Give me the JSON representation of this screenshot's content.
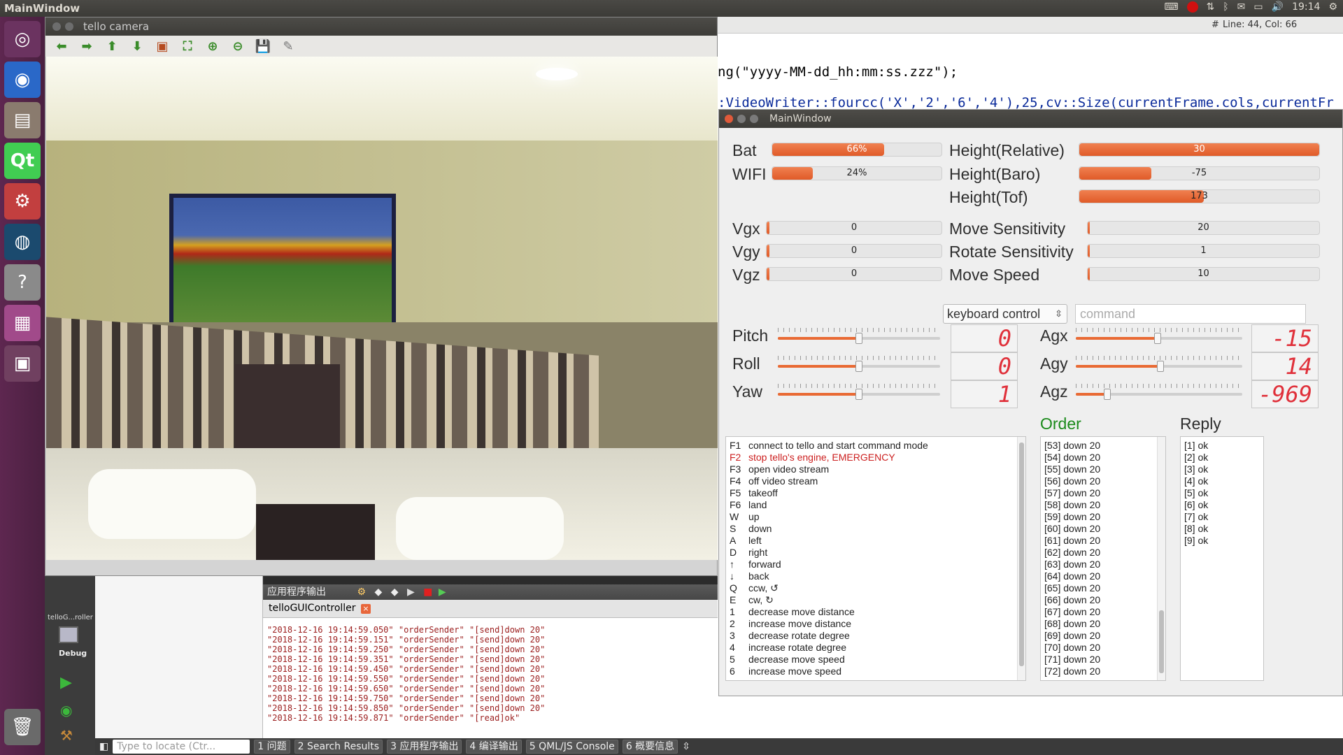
{
  "topbar": {
    "title": "MainWindow",
    "time": "19:14"
  },
  "editor": {
    "status": "Line: 44, Col: 66",
    "hash": "#",
    "line1": "ng(\"yyyy-MM-dd_hh:mm:ss.zzz\");",
    "line2": ":VideoWriter::fourcc('X','2','6','4'),25,cv::Size(currentFrame.cols,currentFr"
  },
  "camera": {
    "title": "tello camera"
  },
  "main": {
    "title": "MainWindow",
    "bat": {
      "label": "Bat",
      "text": "66%",
      "value": 0.66
    },
    "wifi": {
      "label": "WIFI",
      "text": "24%",
      "value": 0.24
    },
    "hrel": {
      "label": "Height(Relative)",
      "text": "30",
      "value": 1.0
    },
    "hbaro": {
      "label": "Height(Baro)",
      "text": "-75",
      "value": 0.3
    },
    "htof": {
      "label": "Height(Tof)",
      "text": "173",
      "value": 0.52
    },
    "vgx": {
      "label": "Vgx",
      "text": "0",
      "value": 0
    },
    "vgy": {
      "label": "Vgy",
      "text": "0",
      "value": 0
    },
    "vgz": {
      "label": "Vgz",
      "text": "0",
      "value": 0
    },
    "msens": {
      "label": "Move Sensitivity",
      "text": "20",
      "value": 0.01
    },
    "rsens": {
      "label": "Rotate Sensitivity",
      "text": "1",
      "value": 0.01
    },
    "mspeed": {
      "label": "Move Speed",
      "text": "10",
      "value": 0.01
    },
    "mode": "keyboard control",
    "command_placeholder": "command",
    "pitch": {
      "label": "Pitch",
      "lcd": "0",
      "value": 0.5
    },
    "roll": {
      "label": "Roll",
      "lcd": "0",
      "value": 0.5
    },
    "yaw": {
      "label": "Yaw",
      "lcd": "1",
      "value": 0.5
    },
    "agx": {
      "label": "Agx",
      "lcd": "-15",
      "value": 0.49
    },
    "agy": {
      "label": "Agy",
      "lcd": "14",
      "value": 0.51
    },
    "agz": {
      "label": "Agz",
      "lcd": "-969",
      "value": 0.19
    },
    "order_title": "Order",
    "reply_title": "Reply"
  },
  "keys": [
    {
      "k": "F1",
      "d": "connect to tello and start command mode"
    },
    {
      "k": "F2",
      "d": "stop tello's engine, EMERGENCY"
    },
    {
      "k": "F3",
      "d": "open video stream"
    },
    {
      "k": "F4",
      "d": "off video stream"
    },
    {
      "k": "F5",
      "d": "takeoff"
    },
    {
      "k": "F6",
      "d": "land"
    },
    {
      "k": "W",
      "d": "up"
    },
    {
      "k": "S",
      "d": "down"
    },
    {
      "k": "A",
      "d": "left"
    },
    {
      "k": "D",
      "d": "right"
    },
    {
      "k": "↑",
      "d": "forward"
    },
    {
      "k": "↓",
      "d": "back"
    },
    {
      "k": "Q",
      "d": "ccw, ↺"
    },
    {
      "k": "E",
      "d": "cw, ↻"
    },
    {
      "k": "1",
      "d": "decrease move distance"
    },
    {
      "k": "2",
      "d": "increase move distance"
    },
    {
      "k": "3",
      "d": "decrease rotate degree"
    },
    {
      "k": "4",
      "d": "increase rotate degree"
    },
    {
      "k": "5",
      "d": "decrease move speed"
    },
    {
      "k": "6",
      "d": "increase move speed"
    }
  ],
  "orders": [
    "[53] down 20",
    "[54] down 20",
    "[55] down 20",
    "[56] down 20",
    "[57] down 20",
    "[58] down 20",
    "[59] down 20",
    "[60] down 20",
    "[61] down 20",
    "[62] down 20",
    "[63] down 20",
    "[64] down 20",
    "[65] down 20",
    "[66] down 20",
    "[67] down 20",
    "[68] down 20",
    "[69] down 20",
    "[70] down 20",
    "[71] down 20",
    "[72] down 20"
  ],
  "replies": [
    "[1] ok",
    "[2] ok",
    "[3] ok",
    "[4] ok",
    "[5] ok",
    "[6] ok",
    "[7] ok",
    "[8] ok",
    "[9] ok"
  ],
  "output": {
    "header": "应用程序输出",
    "tab": "telloGUIController",
    "lines": [
      "\"2018-12-16 19:14:59.050\" \"orderSender\" \"[send]down 20\"",
      "\"2018-12-16 19:14:59.151\" \"orderSender\" \"[send]down 20\"",
      "\"2018-12-16 19:14:59.250\" \"orderSender\" \"[send]down 20\"",
      "\"2018-12-16 19:14:59.351\" \"orderSender\" \"[send]down 20\"",
      "\"2018-12-16 19:14:59.450\" \"orderSender\" \"[send]down 20\"",
      "\"2018-12-16 19:14:59.550\" \"orderSender\" \"[send]down 20\"",
      "\"2018-12-16 19:14:59.650\" \"orderSender\" \"[send]down 20\"",
      "\"2018-12-16 19:14:59.750\" \"orderSender\" \"[send]down 20\"",
      "\"2018-12-16 19:14:59.850\" \"orderSender\" \"[send]down 20\"",
      "\"2018-12-16 19:14:59.871\" \"orderSender\" \"[read]ok\""
    ]
  },
  "qt": {
    "project": "telloG...roller",
    "debug": "Debug",
    "locate_placeholder": "Type to locate (Ctr...",
    "tabs": [
      {
        "n": "1",
        "l": "问题"
      },
      {
        "n": "2",
        "l": "Search Results"
      },
      {
        "n": "3",
        "l": "应用程序输出"
      },
      {
        "n": "4",
        "l": "编译输出"
      },
      {
        "n": "5",
        "l": "QML/JS Console"
      },
      {
        "n": "6",
        "l": "概要信息"
      }
    ]
  },
  "colors": {
    "accent": "#e96a34",
    "lcd": "#e0303a",
    "order_title": "#1a8a1a",
    "emergency": "#cc1f1f"
  }
}
